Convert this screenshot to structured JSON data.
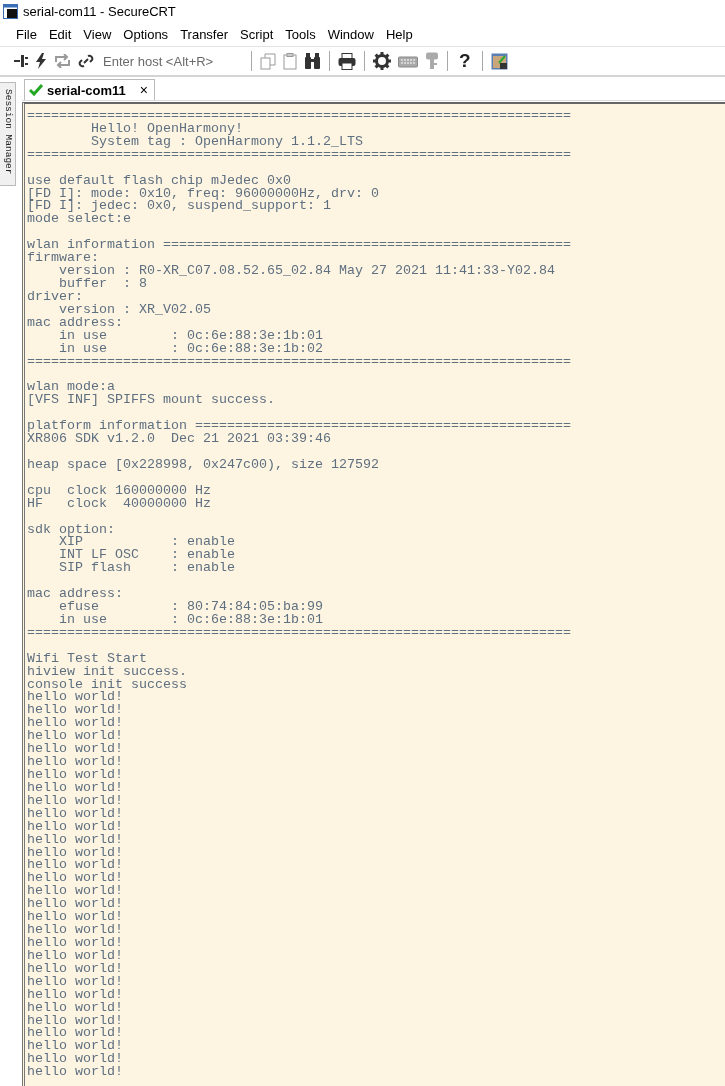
{
  "window": {
    "title": "serial-com11 - SecureCRT"
  },
  "menu": [
    "File",
    "Edit",
    "View",
    "Options",
    "Transfer",
    "Script",
    "Tools",
    "Window",
    "Help"
  ],
  "toolbar": {
    "host_field": {
      "placeholder": "Enter host <Alt+R>"
    },
    "help_glyph": "?"
  },
  "side_panel": {
    "label": "Session Manager"
  },
  "tabs": [
    {
      "label": "serial-com11",
      "selected": true,
      "connected": true,
      "close": "×"
    }
  ],
  "terminal": {
    "blocks": [
      [
        "====================================================================",
        "        Hello! OpenHarmony!",
        "        System tag : OpenHarmony 1.1.2_LTS",
        "===================================================================="
      ],
      [
        "use default flash chip mJedec 0x0",
        "[FD I]: mode: 0x10, freq: 96000000Hz, drv: 0",
        "[FD I]: jedec: 0x0, suspend_support: 1",
        "mode select:e"
      ],
      [
        "wlan information ===================================================",
        "firmware:",
        "    version : R0-XR_C07.08.52.65_02.84 May 27 2021 11:41:33-Y02.84",
        "    buffer  : 8",
        "driver:",
        "    version : XR_V02.05",
        "mac address:",
        "    in use        : 0c:6e:88:3e:1b:01",
        "    in use        : 0c:6e:88:3e:1b:02",
        "===================================================================="
      ],
      [
        "wlan mode:a",
        "[VFS INF] SPIFFS mount success."
      ],
      [
        "platform information ===============================================",
        "XR806 SDK v1.2.0  Dec 21 2021 03:39:46"
      ],
      [
        "heap space [0x228998, 0x247c00), size 127592"
      ],
      [
        "cpu  clock 160000000 Hz",
        "HF   clock  40000000 Hz"
      ],
      [
        "sdk option:",
        "    XIP           : enable",
        "    INT LF OSC    : enable",
        "    SIP flash     : enable"
      ],
      [
        "mac address:",
        "    efuse         : 80:74:84:05:ba:99",
        "    in use        : 0c:6e:88:3e:1b:01",
        "===================================================================="
      ],
      [
        "Wifi Test Start",
        "hiview init success.",
        "console init success",
        "hello world!",
        "hello world!",
        "hello world!",
        "hello world!",
        "hello world!",
        "hello world!",
        "hello world!",
        "hello world!",
        "hello world!",
        "hello world!",
        "hello world!",
        "hello world!",
        "hello world!",
        "hello world!",
        "hello world!",
        "hello world!",
        "hello world!",
        "hello world!",
        "hello world!",
        "hello world!",
        "hello world!",
        "hello world!",
        "hello world!",
        "hello world!",
        "hello world!",
        "hello world!",
        "hello world!",
        "hello world!",
        "hello world!",
        "hello world!"
      ]
    ]
  }
}
